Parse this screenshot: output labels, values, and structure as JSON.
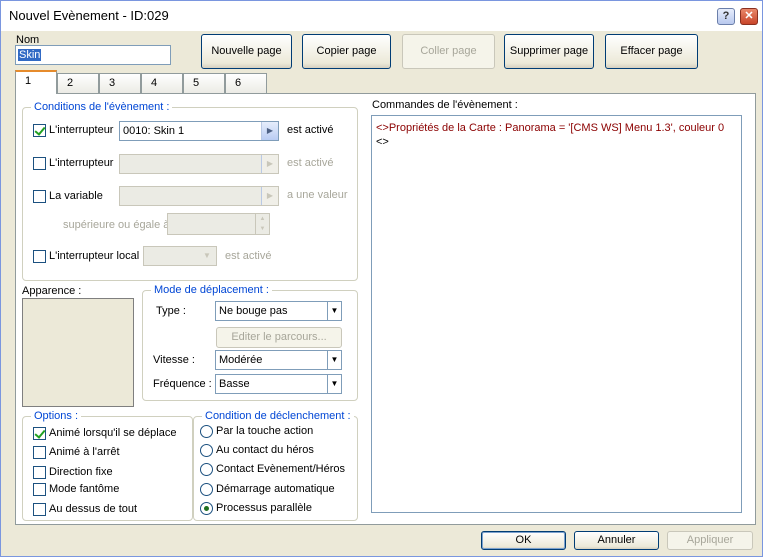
{
  "window": {
    "title": "Nouvel Evènement - ID:029",
    "help": "?",
    "close": "✕"
  },
  "name": {
    "label": "Nom",
    "value": "Skin"
  },
  "page_buttons": [
    {
      "label": "Nouvelle page"
    },
    {
      "label": "Copier page"
    },
    {
      "label": "Coller page"
    },
    {
      "label": "Supprimer page"
    },
    {
      "label": "Effacer page"
    }
  ],
  "tabs": [
    "1",
    "2",
    "3",
    "4",
    "5",
    "6"
  ],
  "conditions": {
    "title": "Conditions de l'évènement :",
    "switch1": {
      "label": "L'interrupteur",
      "value": "0010: Skin 1",
      "suffix": "est activé"
    },
    "switch2": {
      "label": "L'interrupteur",
      "suffix": "est activé"
    },
    "variable": {
      "label": "La variable",
      "suffix": "a une valeur",
      "compare": "supérieure ou égale à"
    },
    "local": {
      "label": "L'interrupteur local",
      "suffix": "est activé"
    }
  },
  "appearance": {
    "label": "Apparence :"
  },
  "movement": {
    "title": "Mode de déplacement :",
    "type_label": "Type :",
    "type_value": "Ne bouge pas",
    "route_button": "Editer le parcours...",
    "speed_label": "Vitesse :",
    "speed_value": "Modérée",
    "freq_label": "Fréquence :",
    "freq_value": "Basse"
  },
  "options": {
    "title": "Options :",
    "items": [
      {
        "label": "Animé lorsqu'il se déplace",
        "checked": true
      },
      {
        "label": "Animé à l'arrêt",
        "checked": false
      },
      {
        "label": "Direction fixe",
        "checked": false
      },
      {
        "label": "Mode fantôme",
        "checked": false
      },
      {
        "label": "Au dessus de tout",
        "checked": false
      }
    ]
  },
  "trigger": {
    "title": "Condition de déclenchement :",
    "items": [
      {
        "label": "Par la touche action",
        "selected": false
      },
      {
        "label": "Au contact du héros",
        "selected": false
      },
      {
        "label": "Contact Evènement/Héros",
        "selected": false
      },
      {
        "label": "Démarrage automatique",
        "selected": false
      },
      {
        "label": "Processus parallèle",
        "selected": true
      }
    ]
  },
  "commands": {
    "label": "Commandes de l'évènement :",
    "lines": [
      "<>Propriétés de la Carte : Panorama = '[CMS WS] Menu 1.3', couleur 0",
      "<>"
    ],
    "line_color": "#8b0000"
  },
  "footer": {
    "ok": "OK",
    "cancel": "Annuler",
    "apply": "Appliquer"
  }
}
